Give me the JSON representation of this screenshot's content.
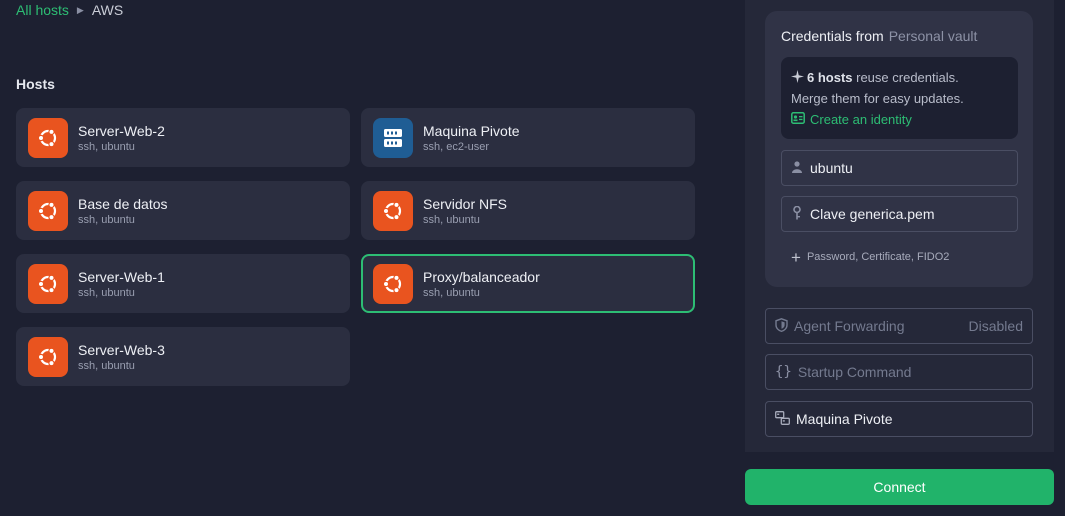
{
  "breadcrumb": {
    "root": "All hosts",
    "current": "AWS"
  },
  "hosts_section": {
    "title": "Hosts"
  },
  "hosts": [
    {
      "name": "Server-Web-2",
      "sub": "ssh, ubuntu",
      "icon": "ubuntu-icon"
    },
    {
      "name": "Maquina Pivote",
      "sub": "ssh, ec2-user",
      "icon": "server-icon"
    },
    {
      "name": "Base de datos",
      "sub": "ssh, ubuntu",
      "icon": "ubuntu-icon"
    },
    {
      "name": "Servidor NFS",
      "sub": "ssh, ubuntu",
      "icon": "ubuntu-icon"
    },
    {
      "name": "Server-Web-1",
      "sub": "ssh, ubuntu",
      "icon": "ubuntu-icon"
    },
    {
      "name": "Proxy/balanceador",
      "sub": "ssh, ubuntu",
      "icon": "ubuntu-icon",
      "selected": true
    },
    {
      "name": "Server-Web-3",
      "sub": "ssh, ubuntu",
      "icon": "ubuntu-icon"
    }
  ],
  "credentials": {
    "label": "Credentials from",
    "vault": "Personal vault",
    "notice_count": "6 hosts",
    "notice_rest": " reuse credentials.",
    "notice_line2": "Merge them for easy updates.",
    "identity_link": "Create an identity",
    "username": "ubuntu",
    "key": "Clave generica.pem",
    "add_options": "Password, Certificate, FIDO2"
  },
  "options": {
    "agent_forwarding": {
      "label": "Agent Forwarding",
      "value": "Disabled"
    },
    "startup_command": {
      "placeholder": "Startup Command"
    },
    "jump_host": {
      "value": "Maquina Pivote"
    }
  },
  "connect_label": "Connect",
  "colors": {
    "accent": "#2dbd74",
    "ubuntu": "#e9541f",
    "server": "#1f5d94",
    "background": "#1d2031"
  }
}
